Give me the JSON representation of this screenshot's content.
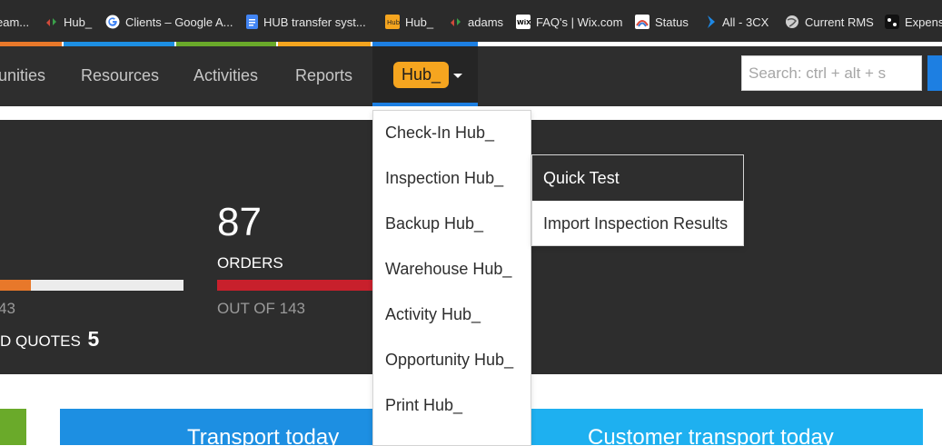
{
  "bookmarks": [
    {
      "label": "eam...",
      "icon": "team-icon",
      "color": "#3a7bd5"
    },
    {
      "label": "Hub_",
      "icon": "hub-arrows-icon",
      "color": "#d04a3a"
    },
    {
      "label": "Clients – Google A...",
      "icon": "google-icon",
      "color": "#ffffff"
    },
    {
      "label": "HUB transfer syst...",
      "icon": "google-docs-icon",
      "color": "#4285f4"
    },
    {
      "label": "Hub_",
      "icon": "hub-logo-icon",
      "color": "#f5a51f"
    },
    {
      "label": "adams",
      "icon": "hub-arrows-icon",
      "color": "#d04a3a"
    },
    {
      "label": "FAQ's | Wix.com",
      "icon": "wix-icon",
      "color": "#ffffff"
    },
    {
      "label": "Status",
      "icon": "status-icon",
      "color": "#e04a3a"
    },
    {
      "label": "All - 3CX",
      "icon": "3cx-icon",
      "color": "#1e88e5"
    },
    {
      "label": "Current RMS",
      "icon": "globe-icon",
      "color": "#cccccc"
    },
    {
      "label": "Expens",
      "icon": "expensify-icon",
      "color": "#111111"
    }
  ],
  "color_strip": [
    "#e8782a",
    "#1d8fe2",
    "#6aaa2a",
    "#f5a51f",
    "#1d7fe2"
  ],
  "nav": {
    "items": [
      "unities",
      "Resources",
      "Activities",
      "Reports"
    ],
    "hub_label": "Hub_",
    "search_placeholder": "Search: ctrl + alt + s"
  },
  "dropdown": {
    "items": [
      "Check-In Hub_",
      "Inspection Hub_",
      "Backup Hub_",
      "Warehouse Hub_",
      "Activity Hub_",
      "Opportunity Hub_",
      "Print Hub_"
    ]
  },
  "submenu": {
    "items": [
      "Quick Test",
      "Import Inspection Results"
    ]
  },
  "stats": {
    "left_sub": "43",
    "orders_value": "87",
    "orders_label": "ORDERS",
    "orders_sub": "OUT OF 143",
    "quotes_label": "D QUOTES",
    "quotes_value": "5",
    "left_bar_fraction": 0.17,
    "orders_bar_fraction": 0.61
  },
  "cards": [
    {
      "label": "Transport today",
      "color": "#1d8fe2"
    },
    {
      "label": "Customer transport today",
      "color": "#1eb0f0"
    }
  ],
  "colors": {
    "accent_orange": "#f5a51f",
    "accent_blue": "#1d7fe2",
    "bar_orange": "#e8782a",
    "bar_red": "#c8202c",
    "green": "#6aaa2a"
  }
}
